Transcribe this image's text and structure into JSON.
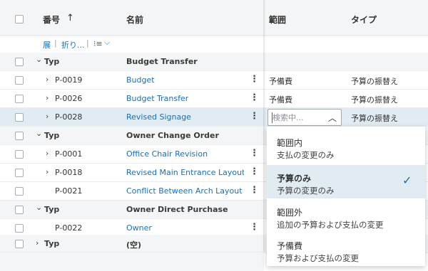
{
  "header": {
    "col_number": "番号",
    "col_name": "名前",
    "col_scope": "範囲",
    "col_type": "タイプ",
    "sort_indicator": "↑"
  },
  "toolbar": {
    "expand_label": "展",
    "collapse_label": "折り...",
    "separator": "|",
    "list_options_glyph": "⁝≡",
    "list_options_caret": "⌵"
  },
  "groups": [
    {
      "label": "Typ",
      "name": "Budget Transfer"
    },
    {
      "label": "Typ",
      "name": "Owner Change Order"
    },
    {
      "label": "Typ",
      "name": "Owner Direct Purchase"
    },
    {
      "label": "Typ",
      "name": "(空)"
    }
  ],
  "rows": [
    {
      "number": "P-0019",
      "name": "Budget",
      "scope": "予備費",
      "type": "予算の振替え"
    },
    {
      "number": "P-0026",
      "name": "Budget Transfer",
      "scope": "予備費",
      "type": "予算の振替え"
    },
    {
      "number": "P-0028",
      "name": "Revised Signage",
      "scope": "",
      "type": "予算の振替え"
    },
    {
      "number": "P-0001",
      "name": "Office Chair Revision",
      "scope": "",
      "type": ""
    },
    {
      "number": "P-0018",
      "name": "Revised Main Entrance Layout ...",
      "scope": "",
      "type": ""
    },
    {
      "number": "P-0021",
      "name": "Conflict Between Arch Layout a...",
      "scope": "",
      "type": ""
    },
    {
      "number": "P-0022",
      "name": "Owner",
      "scope": "",
      "type": ""
    }
  ],
  "scope_filter": {
    "placeholder": "検索中...",
    "caret": "︿"
  },
  "scope_options": [
    {
      "title": "範囲内",
      "description": "支払の変更のみ"
    },
    {
      "title": "予算のみ",
      "description": "予算の変更のみ"
    },
    {
      "title": "範囲外",
      "description": "追加の予算および支払の変更"
    },
    {
      "title": "予備費",
      "description": "予算および支払の変更"
    }
  ],
  "selected_option_index": 1,
  "glyphs": {
    "row_expand": "›",
    "group_collapse": "⌄",
    "group_expand": "›",
    "kebab": "⋮",
    "check": "✓"
  },
  "colors": {
    "link": "#1a6fb5",
    "selected_row": "#e1ebf2",
    "group_row": "#f4f5f6"
  }
}
